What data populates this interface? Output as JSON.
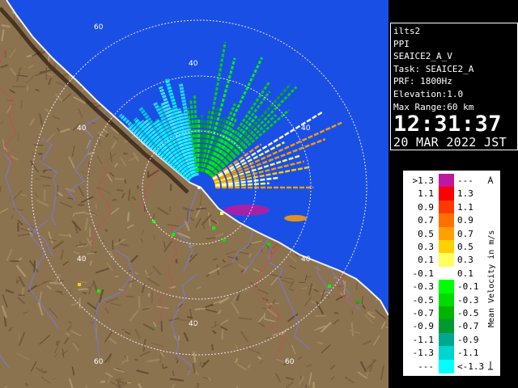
{
  "info": {
    "station": "ilts2",
    "mode": "PPI",
    "product": "SEAICE2_A_V",
    "task": "Task: SEAICE2_A",
    "prf": "PRF: 1800Hz",
    "elevation": "Elevation:1.0",
    "max_range": "Max Range:60 km",
    "time": "12:31:37",
    "date": "20 MAR 2022 JST"
  },
  "map": {
    "range_ring_labels": [
      "40",
      "60"
    ],
    "colors": {
      "sea": "#1a4fe6",
      "land": "#8c7350",
      "rings": "#e0e0f0"
    }
  },
  "legend": {
    "title": "Mean Velocity in m/s",
    "rows": [
      {
        "left": ">1.3",
        "right": "---",
        "color": "#c0189c"
      },
      {
        "left": "1.1",
        "right": "1.3",
        "color": "#ff0000"
      },
      {
        "left": "0.9",
        "right": "1.1",
        "color": "#ff3a00"
      },
      {
        "left": "0.7",
        "right": "0.9",
        "color": "#ff7000"
      },
      {
        "left": "0.5",
        "right": "0.7",
        "color": "#ffa000"
      },
      {
        "left": "0.3",
        "right": "0.5",
        "color": "#ffd000"
      },
      {
        "left": "0.1",
        "right": "0.3",
        "color": "#ffff60"
      },
      {
        "left": "-0.1",
        "right": "0.1",
        "color": "#ffffff"
      },
      {
        "left": "-0.3",
        "right": "-0.1",
        "color": "#00ff00"
      },
      {
        "left": "-0.5",
        "right": "-0.3",
        "color": "#00dc00"
      },
      {
        "left": "-0.7",
        "right": "-0.5",
        "color": "#00b400"
      },
      {
        "left": "-0.9",
        "right": "-0.7",
        "color": "#009a30"
      },
      {
        "left": "-1.1",
        "right": "-0.9",
        "color": "#00a890"
      },
      {
        "left": "-1.3",
        "right": "-1.1",
        "color": "#00d4d0"
      },
      {
        "left": "---",
        "right": "<-1.3",
        "color": "#00ffff"
      }
    ]
  }
}
